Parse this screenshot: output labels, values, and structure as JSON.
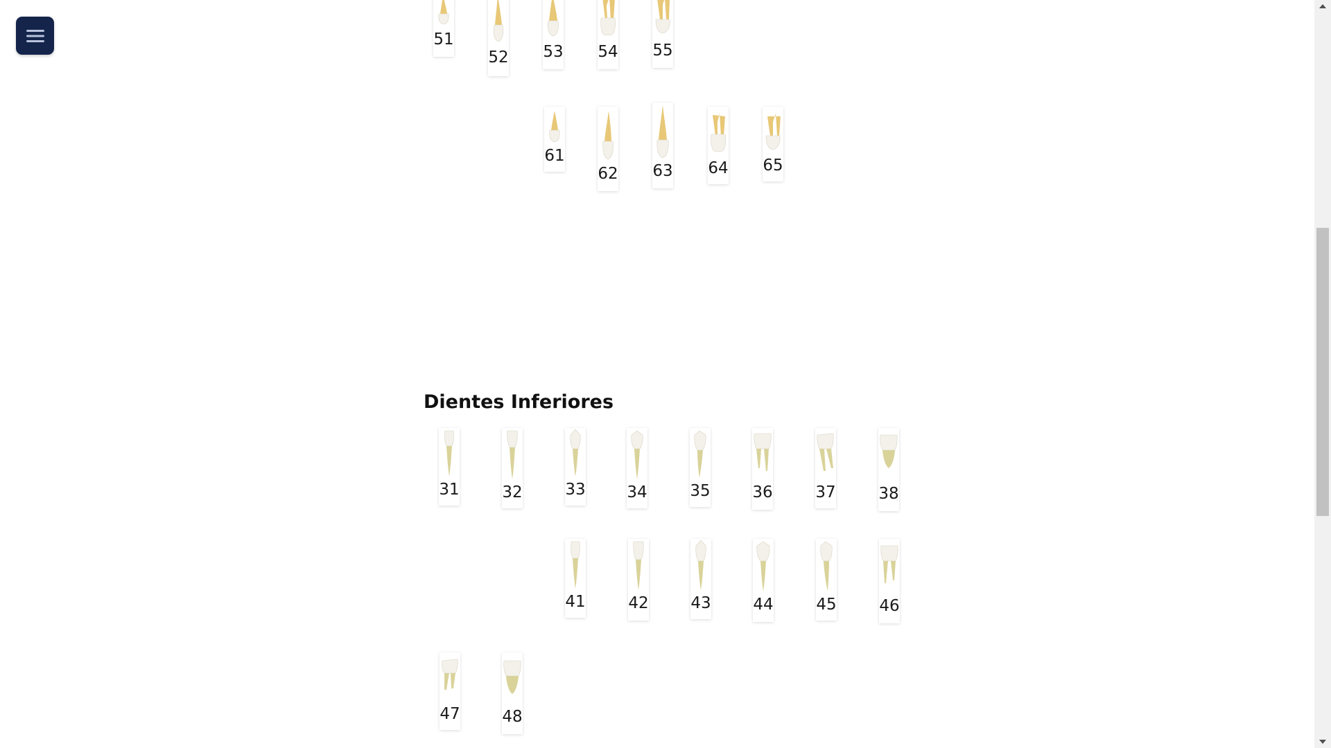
{
  "header": {
    "menu_icon": "hamburger-menu-icon"
  },
  "upper_primary": {
    "row1": [
      "51",
      "52",
      "53",
      "54",
      "55"
    ],
    "row2": [
      "61",
      "62",
      "63",
      "64",
      "65"
    ]
  },
  "lower": {
    "title": "Dientes Inferiores",
    "row1": [
      "31",
      "32",
      "33",
      "34",
      "35",
      "36",
      "37",
      "38"
    ],
    "row2": [
      "41",
      "42",
      "43",
      "44",
      "45",
      "46"
    ],
    "row3": [
      "47",
      "48"
    ]
  },
  "scrollbar": {
    "position_fraction": 0.38
  },
  "colors": {
    "menu_button": "#14244a",
    "upper_root": "#e8c877",
    "lower_root": "#d9d39a",
    "crown": "#f3f1ea"
  }
}
